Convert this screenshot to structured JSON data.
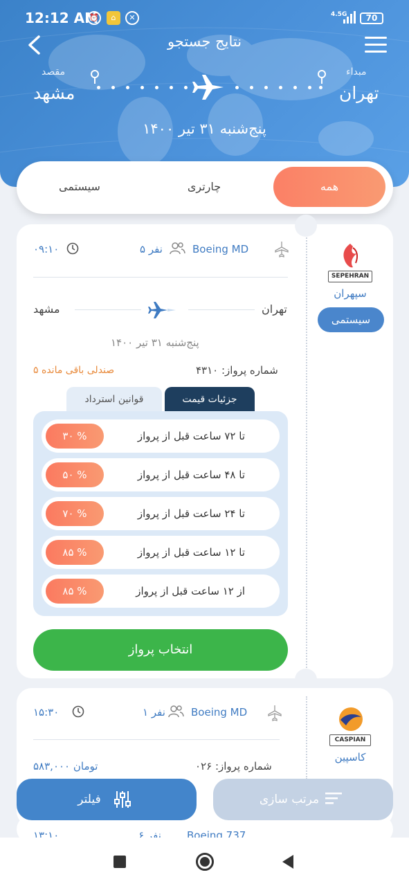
{
  "status": {
    "time": "12:12 AM",
    "network": "4.5G",
    "battery": "70"
  },
  "header": {
    "title": "نتایج جستجو",
    "origin_label": "مبداء",
    "origin_city": "تهران",
    "dest_label": "مقصد",
    "dest_city": "مشهد",
    "date": "پنج‌شنبه ۳۱ تیر ۱۴۰۰"
  },
  "tabs": [
    {
      "label": "همه",
      "active": true
    },
    {
      "label": "چارتری",
      "active": false
    },
    {
      "label": "سیستمی",
      "active": false
    }
  ],
  "flight1": {
    "airline_logo_text": "SEPEHRAN",
    "airline_name": "سپهران",
    "type_badge": "سیستمی",
    "aircraft": "Boeing MD",
    "passengers": "۵ نفر",
    "time": "۰۹:۱۰",
    "from": "تهران",
    "to": "مشهد",
    "date": "پنج‌شنبه ۳۱ تیر ۱۴۰۰",
    "flight_no": "شماره پرواز: ۴۳۱۰",
    "seats_left": "۵ صندلی باقی مانده",
    "tab_price": "جزئیات قیمت",
    "tab_refund": "قوانین استرداد",
    "rules": [
      {
        "text": "تا ۷۲ ساعت قبل از پرواز",
        "pct": "۳۰ %"
      },
      {
        "text": "تا ۴۸ ساعت قبل از پرواز",
        "pct": "۵۰ %"
      },
      {
        "text": "تا ۲۴ ساعت قبل از پرواز",
        "pct": "۷۰ %"
      },
      {
        "text": "تا ۱۲ ساعت قبل از پرواز",
        "pct": "۸۵ %"
      },
      {
        "text": "از ۱۲ ساعت قبل از پرواز",
        "pct": "۸۵ %"
      }
    ],
    "select_label": "انتخاب پرواز"
  },
  "flight2": {
    "airline_logo_text": "CASPIAN",
    "airline_name": "کاسپین",
    "aircraft": "Boeing MD",
    "passengers": "۱ نفر",
    "time": "۱۵:۳۰",
    "flight_no": "شماره پرواز: ۰۲۶",
    "price": "۵۸۳,۰۰۰ تومان"
  },
  "flight3": {
    "aircraft": "Boeing 737",
    "passengers": "۶ نفر",
    "time": "۱۳:۱۰"
  },
  "bottom": {
    "filter_label": "فیلتر",
    "sort_label": "مرتب سازی"
  },
  "colors": {
    "primary": "#4385cb",
    "accent": "#fb8066",
    "green": "#3cb54a"
  }
}
